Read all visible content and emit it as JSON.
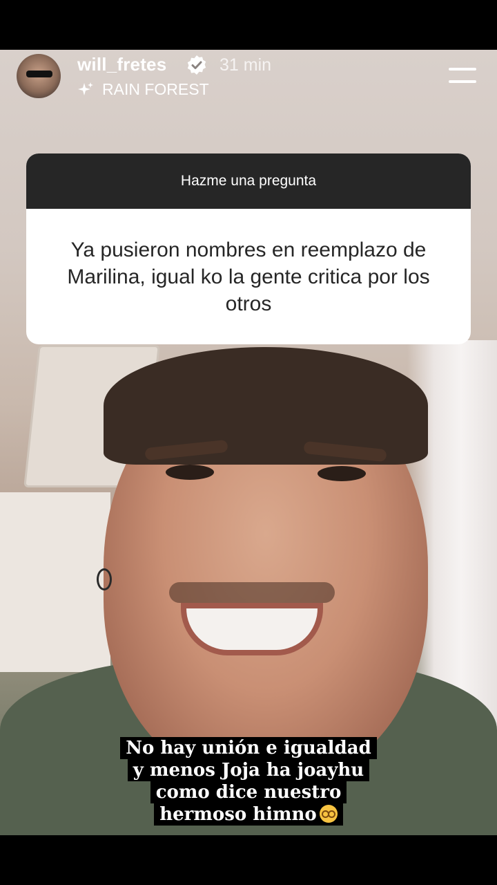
{
  "header": {
    "username": "will_fretes",
    "time": "31 min",
    "music_label": "RAIN FOREST"
  },
  "question_sticker": {
    "title": "Hazme una pregunta",
    "question": "Ya pusieron nombres en reemplazo de Marilina, igual ko la gente critica por los otros"
  },
  "caption": {
    "lines": [
      "No hay unión e igualdad",
      "y menos Joja ha joayhu",
      "como dice nuestro",
      "hermoso himno"
    ]
  },
  "icons": {
    "verified": "verified-badge-icon",
    "music": "sparkle-music-icon",
    "menu": "menu-icon",
    "emoji": "flushed-face-emoji"
  }
}
